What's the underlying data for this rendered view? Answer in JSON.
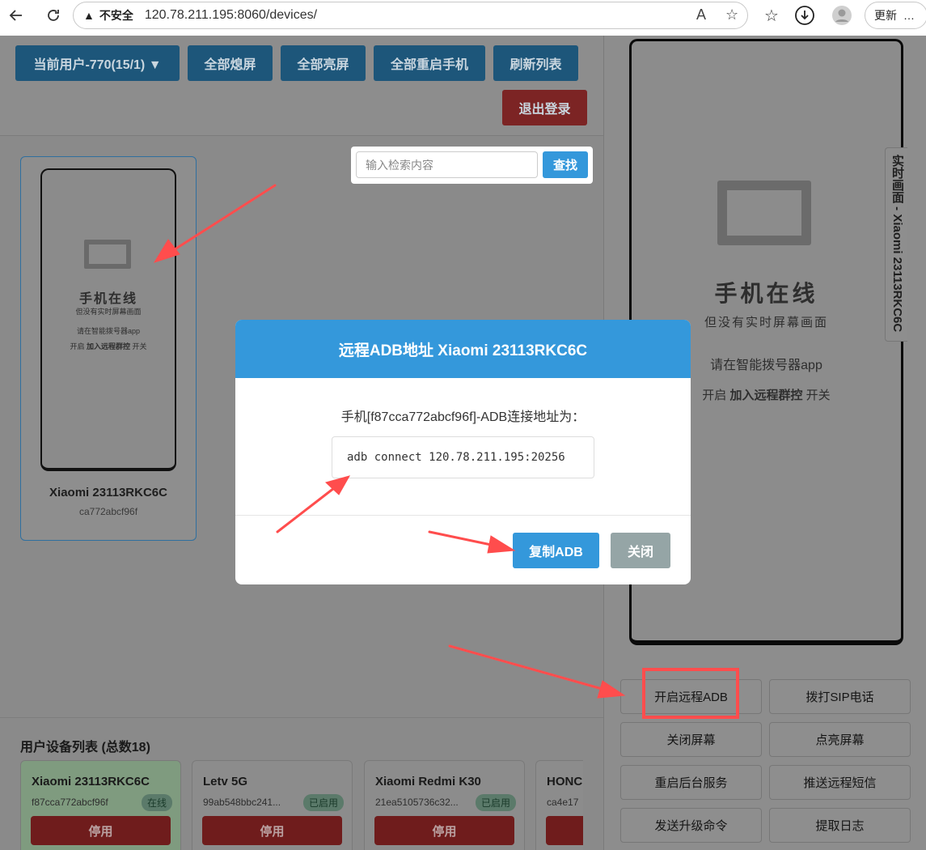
{
  "browser": {
    "warning_label": "不安全",
    "url": "120.78.211.195:8060/devices/",
    "update_label": "更新",
    "more_label": "…"
  },
  "toolbar": {
    "user_label": "当前用户-770(15/1) ▼",
    "all_off_label": "全部熄屏",
    "all_on_label": "全部亮屏",
    "all_reboot_label": "全部重启手机",
    "refresh_label": "刷新列表",
    "logout_label": "退出登录"
  },
  "search": {
    "placeholder": "输入检索内容",
    "button_label": "查找"
  },
  "device_card": {
    "name": "Xiaomi 23113RKC6C",
    "id": "ca772abcf96f",
    "screen_title": "手机在线",
    "screen_sub": "但没有实时屏幕画面",
    "screen_hint": "请在智能拨号器app",
    "screen_hint2_pre": "开启",
    "screen_hint2_bold": "加入远程群控",
    "screen_hint2_post": "开关"
  },
  "device_list": {
    "title": "用户设备列表 (总数18)",
    "items": [
      {
        "name": "Xiaomi 23113RKC6C",
        "id": "f87cca772abcf96f",
        "badge": "在线",
        "stop_label": "停用"
      },
      {
        "name": "Letv 5G",
        "id": "99ab548bbc241...",
        "badge": "已启用",
        "stop_label": "停用"
      },
      {
        "name": "Xiaomi Redmi K30",
        "id": "21ea5105736c32...",
        "badge": "已启用",
        "stop_label": "停用"
      },
      {
        "name": "HONC",
        "id": "ca4e17",
        "badge": "",
        "stop_label": ""
      }
    ]
  },
  "right_panel": {
    "side_tab_label": "实时画面 - Xiaomi 23113RKC6C",
    "screen_title": "手机在线",
    "screen_sub": "但没有实时屏幕画面",
    "screen_hint": "请在智能拨号器app",
    "screen_hint2_pre": "开启",
    "screen_hint2_bold": "加入远程群控",
    "screen_hint2_post": "开关",
    "actions": [
      "开启远程ADB",
      "拨打SIP电话",
      "关闭屏幕",
      "点亮屏幕",
      "重启后台服务",
      "推送远程短信",
      "发送升级命令",
      "提取日志"
    ]
  },
  "modal": {
    "title": "远程ADB地址 Xiaomi 23113RKC6C",
    "message": "手机[f87cca772abcf96f]-ADB连接地址为：",
    "adb_command": "adb connect 120.78.211.195:20256",
    "copy_label": "复制ADB",
    "close_label": "关闭"
  },
  "colors": {
    "primary": "#3498db",
    "secondary": "#95a5a6",
    "danger": "#c0392b",
    "annotation": "#ff4d4d"
  }
}
